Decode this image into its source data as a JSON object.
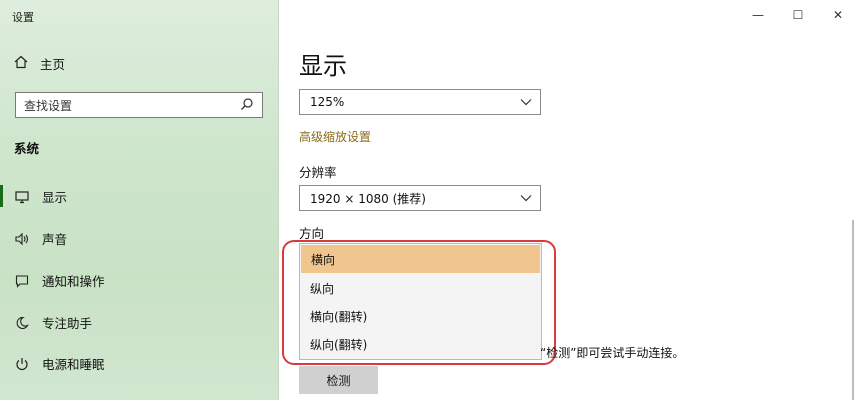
{
  "app": {
    "title": "设置"
  },
  "sidebar": {
    "home": "主页",
    "search_placeholder": "查找设置",
    "section": "系统",
    "items": [
      {
        "label": "显示",
        "icon": "monitor-icon"
      },
      {
        "label": "声音",
        "icon": "speaker-icon"
      },
      {
        "label": "通知和操作",
        "icon": "notification-icon"
      },
      {
        "label": "专注助手",
        "icon": "moon-icon"
      },
      {
        "label": "电源和睡眠",
        "icon": "power-icon"
      }
    ]
  },
  "window_controls": {
    "minimize": "—",
    "maximize": "☐",
    "close": "✕"
  },
  "main": {
    "title": "显示",
    "scale_value": "125%",
    "advanced_scaling_link": "高级缩放设置",
    "resolution_label": "分辨率",
    "resolution_value": "1920 × 1080 (推荐)",
    "orientation_label": "方向",
    "orientation_options": [
      "横向",
      "纵向",
      "横向(翻转)",
      "纵向(翻转)"
    ],
    "selected_orientation": "横向",
    "detect_note": "“检测”即可尝试手动连接。",
    "detect_button": "检测"
  },
  "colors": {
    "accent_link": "#8a6d1a",
    "selected_option": "#f0c68e",
    "highlight_box": "#d93a3a"
  }
}
